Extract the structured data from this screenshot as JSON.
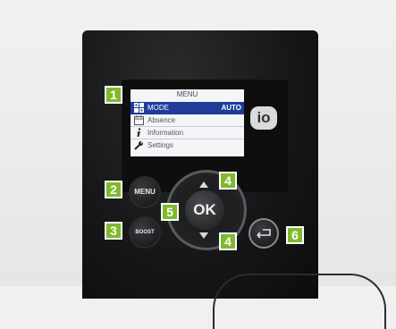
{
  "screen": {
    "title": "MENU",
    "items": [
      {
        "icon": "mode-icon",
        "label": "MODE",
        "value": "AUTO",
        "selected": true
      },
      {
        "icon": "calendar-icon",
        "label": "Absence",
        "value": "",
        "selected": false
      },
      {
        "icon": "info-icon",
        "label": "Information",
        "value": "",
        "selected": false
      },
      {
        "icon": "wrench-icon",
        "label": "Settings",
        "value": "",
        "selected": false
      }
    ]
  },
  "brand": {
    "logo_text": "io"
  },
  "buttons": {
    "menu_label": "MENU",
    "boost_label": "BOOST",
    "ok_label": "OK"
  },
  "callouts": {
    "screen": "1",
    "menu": "2",
    "boost": "3",
    "up": "4",
    "down": "4",
    "ok": "5",
    "back": "6"
  },
  "colors": {
    "callout_green": "#7fb92d",
    "lcd_selection": "#1f3c9a",
    "device_body": "#151617"
  }
}
